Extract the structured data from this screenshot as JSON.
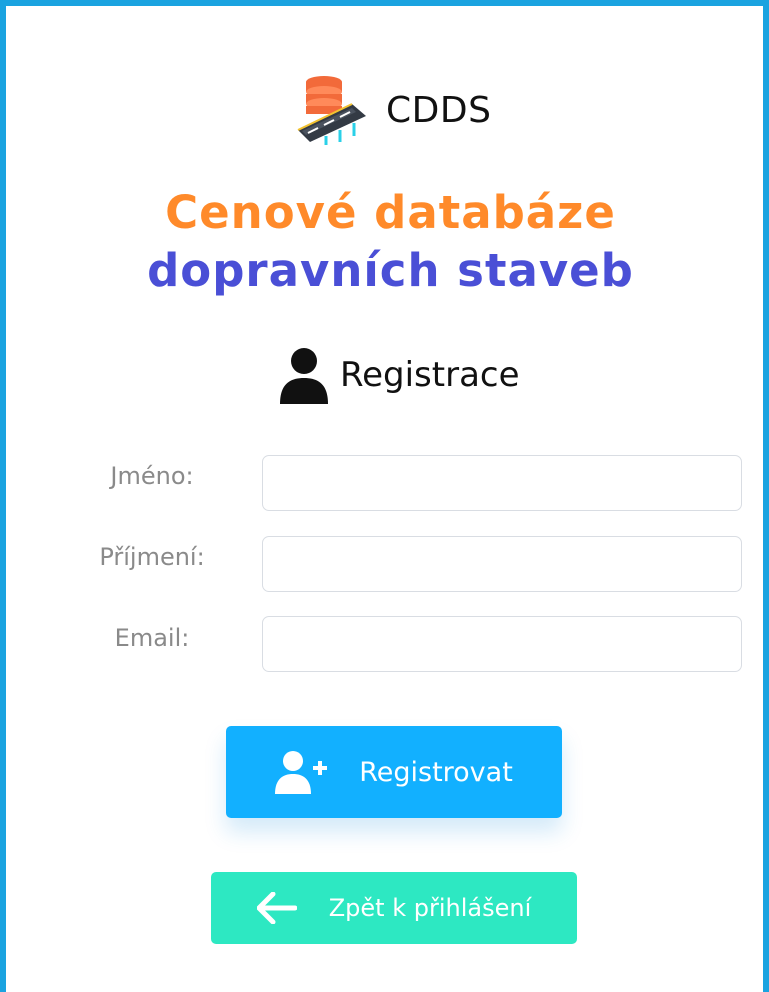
{
  "brand": {
    "name": "CDDS",
    "logo_icon": "database-road-bridge-icon"
  },
  "headline": {
    "line1": "Cenové databáze",
    "line2": "dopravních staveb",
    "line1_color": "#ff8a2a",
    "line2_color": "#4a4fd6"
  },
  "section": {
    "title": "Registrace",
    "icon": "user-icon"
  },
  "form": {
    "fields": [
      {
        "label": "Jméno:",
        "value": "",
        "placeholder": ""
      },
      {
        "label": "Příjmení:",
        "value": "",
        "placeholder": ""
      },
      {
        "label": "Email:",
        "value": "",
        "placeholder": ""
      }
    ]
  },
  "buttons": {
    "register": {
      "label": "Registrovat",
      "icon": "user-plus-icon",
      "color": "#12b0ff"
    },
    "back": {
      "label": "Zpět k přihlášení",
      "icon": "arrow-left-icon",
      "color": "#2de8c2"
    }
  },
  "theme": {
    "frame_border": "#1aa3e0"
  }
}
